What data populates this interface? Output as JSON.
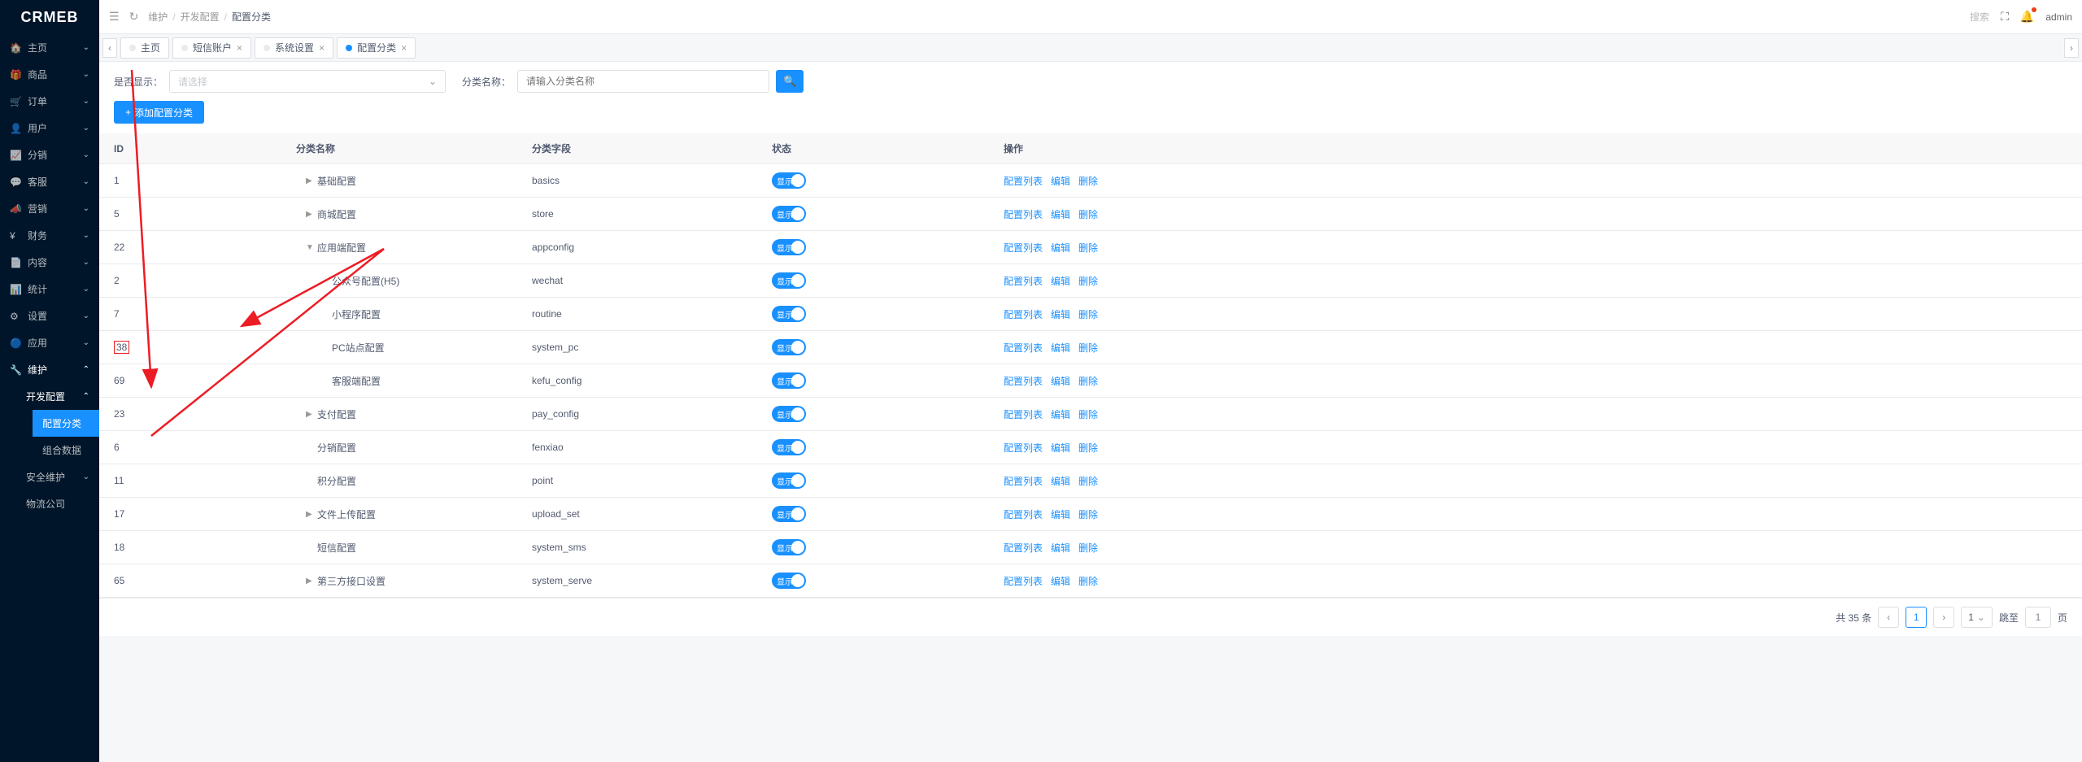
{
  "logo": "CRMEB",
  "sidebar": {
    "items": [
      {
        "icon": "🏠",
        "label": "主页"
      },
      {
        "icon": "🎁",
        "label": "商品"
      },
      {
        "icon": "🛒",
        "label": "订单"
      },
      {
        "icon": "👤",
        "label": "用户"
      },
      {
        "icon": "📈",
        "label": "分销"
      },
      {
        "icon": "💬",
        "label": "客服"
      },
      {
        "icon": "📣",
        "label": "营销"
      },
      {
        "icon": "¥",
        "label": "财务"
      },
      {
        "icon": "📄",
        "label": "内容"
      },
      {
        "icon": "📊",
        "label": "统计"
      },
      {
        "icon": "⚙",
        "label": "设置"
      },
      {
        "icon": "🔵",
        "label": "应用"
      },
      {
        "icon": "🔧",
        "label": "维护"
      }
    ],
    "sub": {
      "dev_config": "开发配置",
      "config_category": "配置分类",
      "combo_data": "组合数据",
      "security_maintenance": "安全维护",
      "logistics_company": "物流公司"
    }
  },
  "header": {
    "breadcrumb": [
      "维护",
      "开发配置",
      "配置分类"
    ],
    "search_placeholder": "搜索",
    "user": "admin"
  },
  "tabs": [
    {
      "label": "主页",
      "closable": false,
      "active": false
    },
    {
      "label": "短信账户",
      "closable": true,
      "active": false
    },
    {
      "label": "系统设置",
      "closable": true,
      "active": false
    },
    {
      "label": "配置分类",
      "closable": true,
      "active": true
    }
  ],
  "filters": {
    "show_label": "是否显示：",
    "show_placeholder": "请选择",
    "name_label": "分类名称：",
    "name_placeholder": "请输入分类名称"
  },
  "add_button": "添加配置分类",
  "table": {
    "headers": {
      "id": "ID",
      "name": "分类名称",
      "field": "分类字段",
      "status": "状态",
      "action": "操作"
    },
    "status_on": "显示",
    "actions": {
      "list": "配置列表",
      "edit": "编辑",
      "del": "删除"
    },
    "rows": [
      {
        "id": "1",
        "indent": 0,
        "toggle": "▶",
        "name": "基础配置",
        "field": "basics"
      },
      {
        "id": "5",
        "indent": 0,
        "toggle": "▶",
        "name": "商城配置",
        "field": "store"
      },
      {
        "id": "22",
        "indent": 0,
        "toggle": "▼",
        "name": "应用端配置",
        "field": "appconfig"
      },
      {
        "id": "2",
        "indent": 1,
        "toggle": "",
        "name": "公众号配置(H5)",
        "field": "wechat"
      },
      {
        "id": "7",
        "indent": 1,
        "toggle": "",
        "name": "小程序配置",
        "field": "routine"
      },
      {
        "id": "38",
        "indent": 1,
        "toggle": "",
        "name": "PC站点配置",
        "field": "system_pc",
        "hl": true
      },
      {
        "id": "69",
        "indent": 1,
        "toggle": "",
        "name": "客服端配置",
        "field": "kefu_config"
      },
      {
        "id": "23",
        "indent": 0,
        "toggle": "▶",
        "name": "支付配置",
        "field": "pay_config"
      },
      {
        "id": "6",
        "indent": 0,
        "toggle": "",
        "name": "分销配置",
        "field": "fenxiao"
      },
      {
        "id": "11",
        "indent": 0,
        "toggle": "",
        "name": "积分配置",
        "field": "point"
      },
      {
        "id": "17",
        "indent": 0,
        "toggle": "▶",
        "name": "文件上传配置",
        "field": "upload_set"
      },
      {
        "id": "18",
        "indent": 0,
        "toggle": "",
        "name": "短信配置",
        "field": "system_sms"
      },
      {
        "id": "65",
        "indent": 0,
        "toggle": "▶",
        "name": "第三方接口设置",
        "field": "system_serve"
      }
    ]
  },
  "pagination": {
    "total_text": "共 35 条",
    "current": "1",
    "goto_prefix": "跳至",
    "goto_suffix": "页"
  }
}
